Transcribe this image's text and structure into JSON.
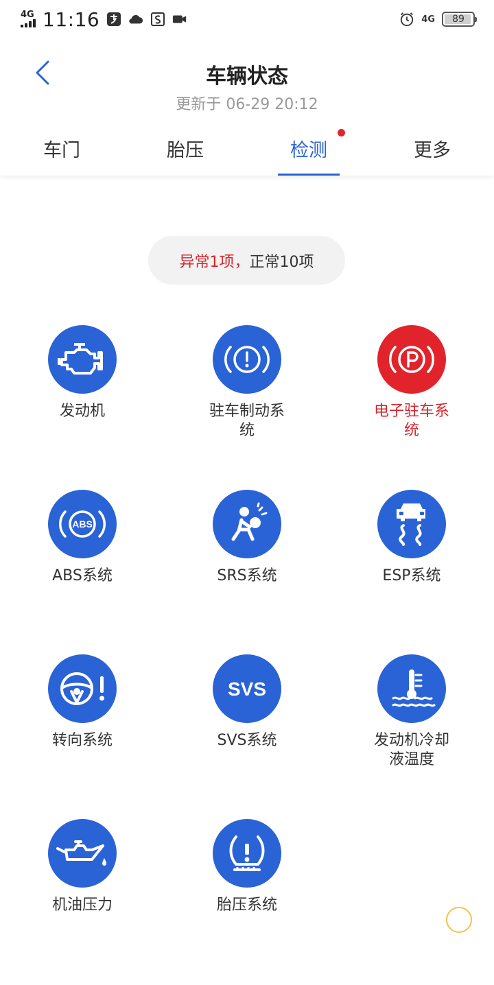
{
  "status_bar": {
    "network": "4G",
    "time": "11:16",
    "right_network": "4G",
    "battery": "89"
  },
  "header": {
    "title": "车辆状态",
    "subtitle": "更新于 06-29 20:12"
  },
  "tabs": [
    {
      "label": "车门",
      "active": false
    },
    {
      "label": "胎压",
      "active": false
    },
    {
      "label": "检测",
      "active": true,
      "badge": true
    },
    {
      "label": "更多",
      "active": false
    }
  ],
  "summary": {
    "abnormal": "异常1项，",
    "normal": "正常10项"
  },
  "items": [
    {
      "label": "发动机",
      "icon": "engine-icon",
      "status": "normal"
    },
    {
      "label": "驻车制动系统",
      "icon": "parking-brake-warning-icon",
      "status": "normal"
    },
    {
      "label": "电子驻车系统",
      "icon": "electronic-parking-icon",
      "status": "abnormal"
    },
    {
      "label": "ABS系统",
      "icon": "abs-icon",
      "status": "normal"
    },
    {
      "label": "SRS系统",
      "icon": "airbag-icon",
      "status": "normal"
    },
    {
      "label": "ESP系统",
      "icon": "esp-skid-icon",
      "status": "normal"
    },
    {
      "label": "转向系统",
      "icon": "steering-warning-icon",
      "status": "normal"
    },
    {
      "label": "SVS系统",
      "icon": "svs-icon",
      "status": "normal"
    },
    {
      "label": "发动机冷却液温度",
      "icon": "coolant-temperature-icon",
      "status": "normal"
    },
    {
      "label": "机油压力",
      "icon": "oil-pressure-icon",
      "status": "normal"
    },
    {
      "label": "胎压系统",
      "icon": "tire-pressure-icon",
      "status": "normal"
    }
  ],
  "colors": {
    "accent": "#2a63d6",
    "alert": "#e1242b",
    "floating_ring": "#f1c34a"
  }
}
